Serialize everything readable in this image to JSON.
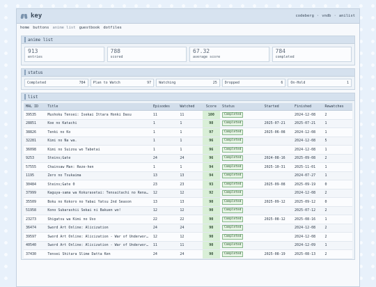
{
  "app": {
    "title": "key",
    "links": [
      "codeberg",
      "vndb",
      "anilist"
    ],
    "sep": "·"
  },
  "nav": [
    "home",
    "buttons",
    "anime list",
    "guestbook",
    "dotfiles"
  ],
  "anime_list": {
    "heading": "anime list",
    "stats": [
      {
        "value": "913",
        "label": "entries"
      },
      {
        "value": "788",
        "label": "scored"
      },
      {
        "value": "67.32",
        "label": "average score"
      },
      {
        "value": "784",
        "label": "completed"
      }
    ]
  },
  "status": {
    "heading": "status",
    "items": [
      {
        "label": "Completed",
        "count": "784"
      },
      {
        "label": "Plan to Watch",
        "count": "97"
      },
      {
        "label": "Watching",
        "count": "25"
      },
      {
        "label": "Dropped",
        "count": "6"
      },
      {
        "label": "On-Hold",
        "count": "1"
      }
    ]
  },
  "list": {
    "heading": "list",
    "columns": [
      "MAL ID",
      "Title",
      "Episodes",
      "Watched",
      "Score",
      "Status",
      "Started",
      "Finished",
      "Rewatches"
    ],
    "rows": [
      [
        "39535",
        "Mushoku Tensei: Isekai Ittara Honki Dasu",
        "11",
        "11",
        "100",
        "Completed",
        "",
        "2024-12-08",
        "2"
      ],
      [
        "28851",
        "Koe no Katachi",
        "1",
        "1",
        "98",
        "Completed",
        "2025-07-21",
        "2025-07-21",
        "1"
      ],
      [
        "38826",
        "Tenki no Ko",
        "1",
        "1",
        "97",
        "Completed",
        "2025-06-08",
        "2024-12-08",
        "1"
      ],
      [
        "32281",
        "Kimi no Na wa.",
        "1",
        "1",
        "96",
        "Completed",
        "",
        "2024-12-08",
        "5"
      ],
      [
        "36098",
        "Kimi no Suizou wo Tabetai",
        "1",
        "1",
        "96",
        "Completed",
        "",
        "2024-12-08",
        "1"
      ],
      [
        "9253",
        "Steins;Gate",
        "24",
        "24",
        "96",
        "Completed",
        "2024-08-16",
        "2025-09-08",
        "2"
      ],
      [
        "57555",
        "Chainsaw Man: Reze-hen",
        "1",
        "1",
        "94",
        "Completed",
        "2025-10-31",
        "2025-11-01",
        "1"
      ],
      [
        "1195",
        "Zero no Tsukaima",
        "13",
        "13",
        "94",
        "Completed",
        "",
        "2024-07-27",
        "1"
      ],
      [
        "30484",
        "Steins;Gate 0",
        "23",
        "23",
        "93",
        "Completed",
        "2025-09-08",
        "2025-09-19",
        "0"
      ],
      [
        "37999",
        "Kaguya-sama wa Kokurasetai: Tensaitachi no Renai Zunousen",
        "12",
        "12",
        "92",
        "Completed",
        "",
        "2024-12-08",
        "2"
      ],
      [
        "35509",
        "Boku no Kokoro no Yabai Yatsu 2nd Season",
        "13",
        "13",
        "90",
        "Completed",
        "2025-09-12",
        "2025-09-12",
        "0"
      ],
      [
        "51958",
        "Kono Subarashii Sekai ni Bakuen wo!",
        "12",
        "12",
        "90",
        "Completed",
        "",
        "2025-07-12",
        "2"
      ],
      [
        "23273",
        "Shigatsu wa Kimi no Uso",
        "22",
        "22",
        "90",
        "Completed",
        "2025-08-12",
        "2025-08-16",
        "1"
      ],
      [
        "36474",
        "Sword Art Online: Alicization",
        "24",
        "24",
        "90",
        "Completed",
        "",
        "2024-12-08",
        "2"
      ],
      [
        "39597",
        "Sword Art Online: Alicization - War of Underworld",
        "12",
        "12",
        "90",
        "Completed",
        "",
        "2024-12-08",
        "2"
      ],
      [
        "40540",
        "Sword Art Online: Alicization - War of Underworld 2nd Season",
        "11",
        "11",
        "90",
        "Completed",
        "",
        "2024-12-09",
        "1"
      ],
      [
        "37430",
        "Tensei Shitara Slime Datta Ken",
        "24",
        "24",
        "90",
        "Completed",
        "2025-08-19",
        "2025-08-13",
        "2"
      ]
    ]
  },
  "colors": {
    "background": "#e8f1fb",
    "header": "#d7e3f0",
    "score_bg": "#d9efd7",
    "badge_border": "#86b78a"
  }
}
